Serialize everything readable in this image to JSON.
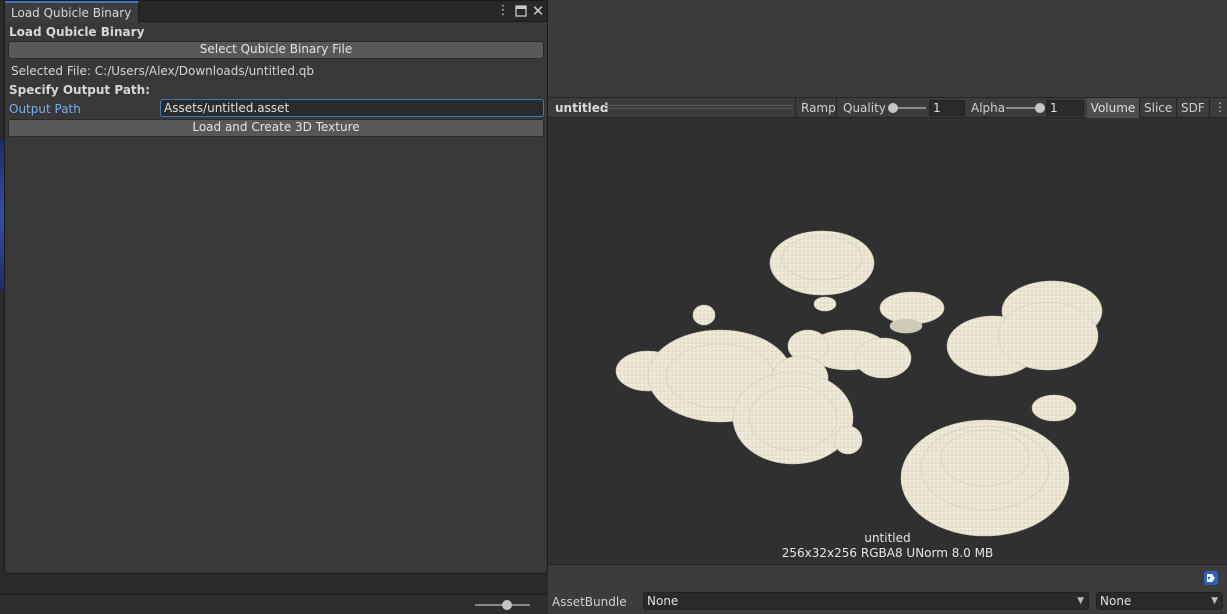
{
  "window": {
    "tab_title": "Load Qubicle Binary",
    "header": "Load Qubicle Binary",
    "select_file_button": "Select Qubicle Binary File",
    "selected_file_text": "Selected File: C:/Users/Alex/Downloads/untitled.qb",
    "output_header": "Specify Output Path:",
    "output_path_label": "Output Path",
    "output_path_value": "Assets/untitled.asset",
    "load_create_button": "Load and Create 3D Texture",
    "icons": [
      "more-vertical-icon",
      "maximize-icon",
      "close-icon"
    ]
  },
  "preview": {
    "toolbar": {
      "asset_name": "untitled",
      "ramp": "Ramp",
      "quality_label": "Quality",
      "quality_value": "1",
      "alpha_label": "Alpha",
      "alpha_value": "1",
      "volume": "Volume",
      "slice": "Slice",
      "sdf": "SDF"
    },
    "caption_name": "untitled",
    "caption_info": "256x32x256 RGBA8 UNorm 8.0 MB",
    "asset_bundle": {
      "label": "AssetBundle",
      "bundle_value": "None",
      "variant_value": "None"
    }
  },
  "colors": {
    "accent": "#3a79bb",
    "window_bg": "#383838",
    "preview_bg": "#303030",
    "voxel_color": "#ece8d6"
  }
}
